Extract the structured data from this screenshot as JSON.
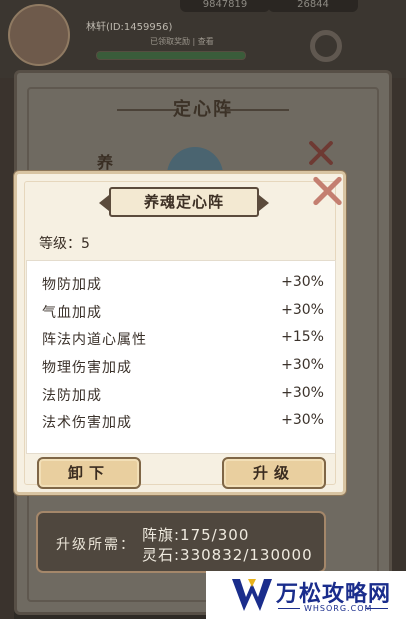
{
  "background": {
    "resources": [
      "9847819",
      "26844"
    ],
    "player_name": "林轩(ID:1459956)",
    "player_sub": "已领取奖励 | 查看",
    "panel_title": "定心阵",
    "side_text": "养"
  },
  "dialog": {
    "title": "养魂定心阵",
    "level_label": "等级：",
    "level_value": "5",
    "attributes": [
      {
        "name": "物防加成",
        "value": "+30%"
      },
      {
        "name": "气血加成",
        "value": "+30%"
      },
      {
        "name": "阵法内道心属性",
        "value": "+15%"
      },
      {
        "name": "物理伤害加成",
        "value": "+30%"
      },
      {
        "name": "法防加成",
        "value": "+30%"
      },
      {
        "name": "法术伤害加成",
        "value": "+30%"
      }
    ],
    "buttons": {
      "unload": "卸下",
      "upgrade": "升级"
    }
  },
  "requirements": {
    "label": "升级所需：",
    "line1": "阵旗:175/300",
    "line2": "灵石:330832/130000"
  },
  "watermark": {
    "brand": "万松攻略网",
    "domain": "WHSORG.COM"
  },
  "colors": {
    "accent_red": "#c47f70",
    "button_gold": "#e9cf9f",
    "brand_blue": "#1a2d8c"
  }
}
